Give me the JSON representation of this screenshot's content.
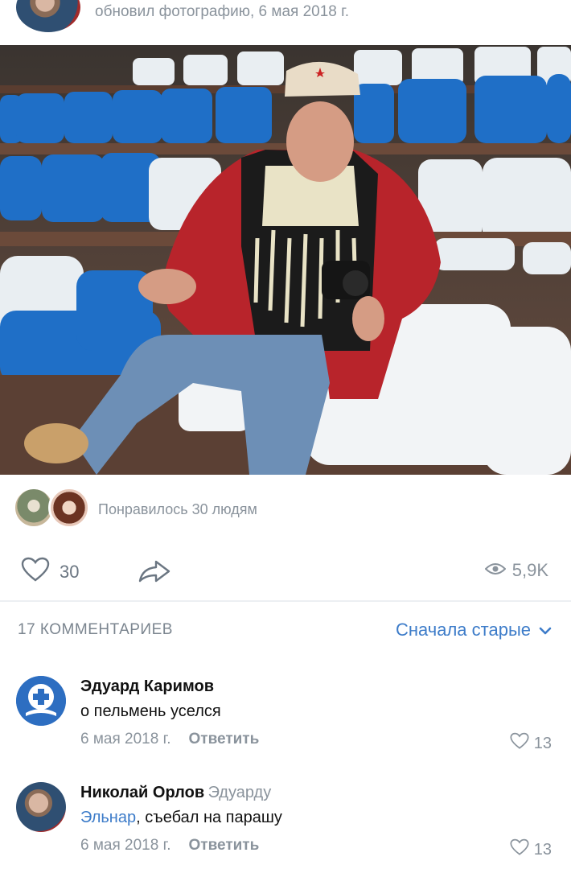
{
  "post": {
    "header_text": "обновил фотографию, 6 мая 2018 г.",
    "likers_text": "Понравилось 30 людям",
    "likes_count": "30",
    "views_count": "5,9K"
  },
  "comments_section": {
    "count_label": "17 КОММЕНТАРИЕВ",
    "sort_label": "Сначала старые"
  },
  "comments": [
    {
      "author": "Эдуард Каримов",
      "reply_to": "",
      "mention": "",
      "text": "о пельмень уселся",
      "date": "6 мая 2018 г.",
      "reply_label": "Ответить",
      "likes": "13"
    },
    {
      "author": "Николай Орлов",
      "reply_to": "Эдуарду",
      "mention": "Эльнар",
      "text": ", съебал на парашу",
      "date": "6 мая 2018 г.",
      "reply_label": "Ответить",
      "likes": "13"
    }
  ],
  "colors": {
    "accent": "#3d7cc9",
    "muted": "#8a939c",
    "divider": "#eceff2"
  },
  "icons": {
    "like": "heart-icon",
    "share": "share-arrow-icon",
    "views": "eye-icon",
    "sort": "chevron-down-icon"
  }
}
